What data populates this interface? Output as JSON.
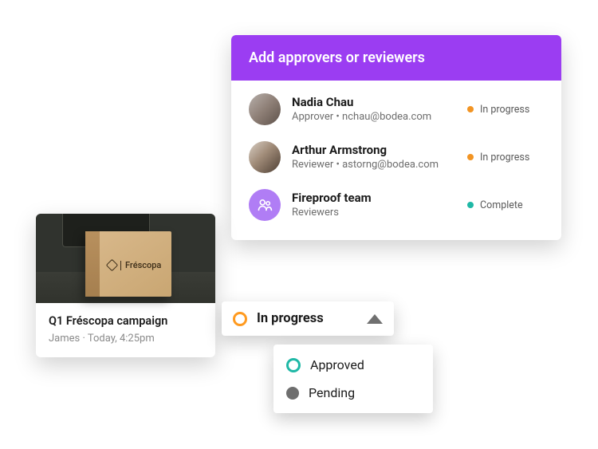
{
  "approvers": {
    "header_title": "Add approvers or reviewers",
    "rows": [
      {
        "name": "Nadia Chau",
        "role": "Approver",
        "separator": " • ",
        "email": "nchau@bodea.com",
        "status_label": "In progress",
        "status_color": "orange"
      },
      {
        "name": "Arthur Armstrong",
        "role": "Reviewer",
        "separator": "  •  ",
        "email": "astorng@bodea.com",
        "status_label": "In progress",
        "status_color": "orange"
      },
      {
        "name": "Fireproof team",
        "role": "Reviewers",
        "separator": "",
        "email": "",
        "status_label": "Complete",
        "status_color": "teal"
      }
    ]
  },
  "campaign_card": {
    "box_brand": "Fréscopa",
    "title": "Q1 Fréscopa campaign",
    "author": "James",
    "meta_sep": " · ",
    "timestamp": "Today, 4:25pm"
  },
  "status_dropdown": {
    "selected": "In progress",
    "options": [
      {
        "label": "Approved",
        "style": "ring-teal"
      },
      {
        "label": "Pending",
        "style": "solid-grey"
      }
    ]
  },
  "colors": {
    "accent_purple": "#9b3df2",
    "status_orange": "#f29423",
    "status_teal": "#1fb8a6"
  }
}
